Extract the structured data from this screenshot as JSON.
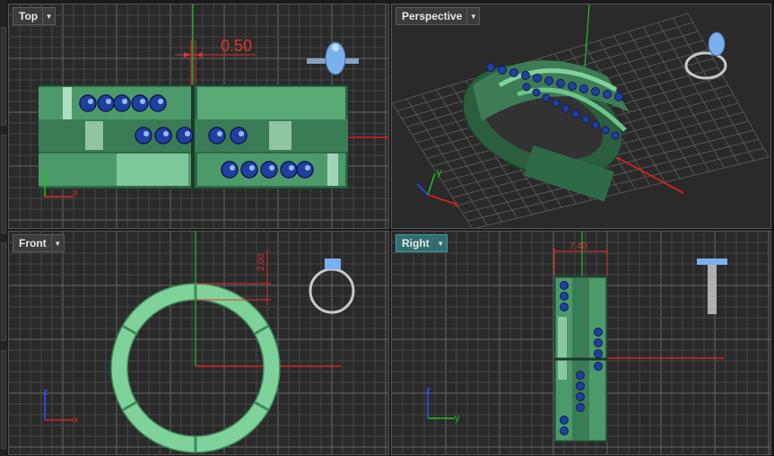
{
  "viewports": {
    "top": {
      "label": "Top",
      "dimension": "0.50"
    },
    "perspective": {
      "label": "Perspective"
    },
    "front": {
      "label": "Front",
      "dimension": "2.00"
    },
    "right": {
      "label": "Right",
      "dimension": "7.40"
    }
  },
  "axes": {
    "x": "x",
    "y": "y",
    "z": "z"
  },
  "colors": {
    "viewport_bg": "#2a2a2a",
    "grid": "#4a4a4a",
    "grid_major": "#6a6a6a",
    "x_axis": "#e02020",
    "y_axis": "#20c020",
    "z_axis": "#3050ff",
    "ring_green": "#3f8a5a",
    "ring_light": "#7fd39a",
    "gem_blue": "#2040a0",
    "active_tab": "#2f6f72"
  }
}
